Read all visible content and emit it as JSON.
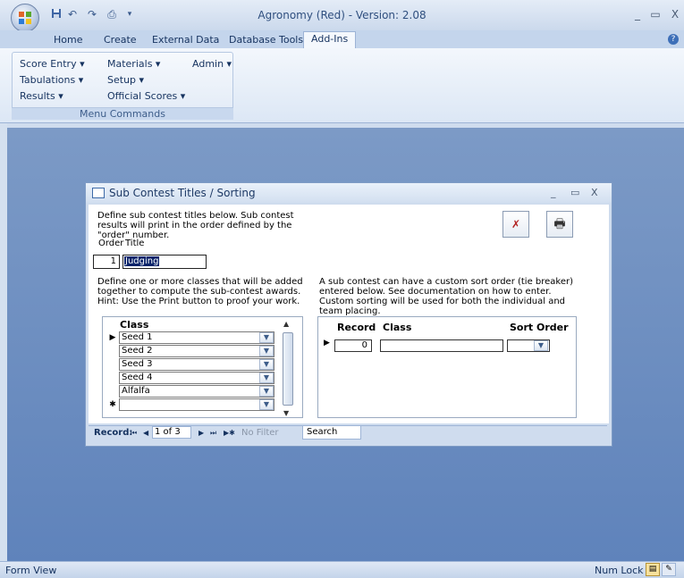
{
  "app": {
    "title": "Agronomy (Red) - Version: 2.08",
    "quick_access": [
      "save-icon",
      "undo-icon",
      "redo-icon",
      "print-icon"
    ],
    "window_controls": [
      "_",
      "▭",
      "X"
    ]
  },
  "ribbon": {
    "tabs": [
      "Home",
      "Create",
      "External Data",
      "Database Tools",
      "Add-Ins"
    ],
    "active_tab": "Add-Ins",
    "commands": [
      "Score Entry ▾",
      "Materials ▾",
      "Admin ▾",
      "Tabulations ▾",
      "Setup ▾",
      "Results ▾",
      "Official Scores ▾"
    ],
    "group_label": "Menu Commands"
  },
  "dialog": {
    "title": "Sub Contest Titles / Sorting",
    "controls": [
      "_",
      "▭",
      "X"
    ],
    "intro": "Define sub contest titles below.  Sub contest results will print in the order defined by the \"order\" number.",
    "order_label": "Order",
    "title_label": "Title",
    "order_value": "1",
    "title_value": "Judging",
    "hint": "Define one or more classes that will be added together to compute the sub-contest awards.  Hint: Use the Print button to proof your work.",
    "sort_hint": "A sub contest can have a custom sort order (tie breaker) entered below.  See documentation on how to enter. Custom sorting will be used for both the individual and team placing.",
    "delete_icon": "✗",
    "print_icon": "🖶"
  },
  "class_form": {
    "header": "Class",
    "rows": [
      "Seed 1",
      "Seed 2",
      "Seed 3",
      "Seed 4",
      "Alfalfa",
      ""
    ],
    "selector_current": "▶",
    "selector_new": "✱",
    "dropdown_glyph": "▼"
  },
  "nav": {
    "record_label": "Record:",
    "first": "⏮",
    "prev": "◀",
    "position": "1 of 3",
    "next": "▶",
    "last": "⏭",
    "new": "▶✱",
    "no_filter": "No Filter",
    "search": "Search"
  },
  "sort_form": {
    "headers": {
      "record": "Record",
      "class": "Class",
      "sort_order": "Sort Order"
    },
    "record_value": "0",
    "selector": "▶",
    "dropdown_glyph": "▼"
  },
  "status": {
    "view": "Form View",
    "num_lock": "Num Lock"
  }
}
